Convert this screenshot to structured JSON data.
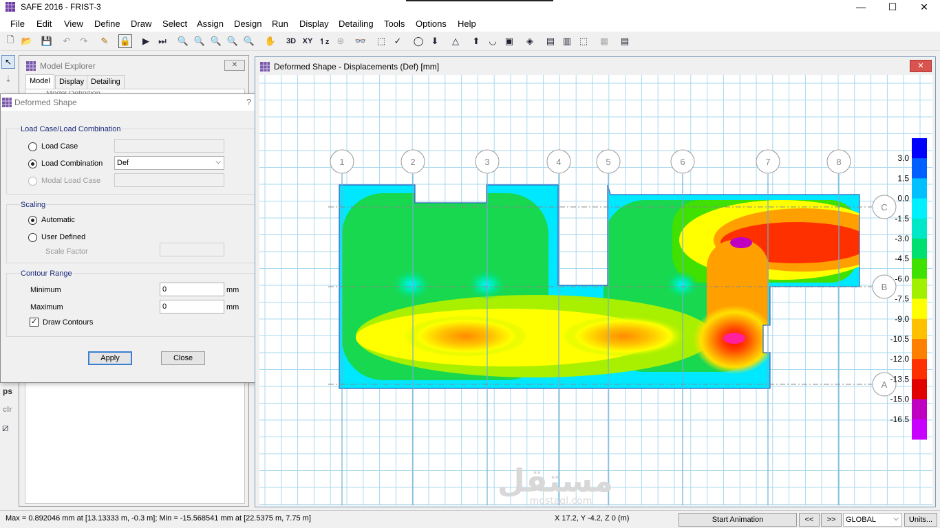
{
  "app": {
    "title": "SAFE 2016 - FRIST-3",
    "window_buttons": [
      "—",
      "☐",
      "✕"
    ]
  },
  "menu": [
    "File",
    "Edit",
    "View",
    "Define",
    "Draw",
    "Select",
    "Assign",
    "Design",
    "Run",
    "Display",
    "Detailing",
    "Tools",
    "Options",
    "Help"
  ],
  "toolbar_icons": [
    "new-file-icon",
    "open-folder-icon",
    "save-icon",
    "undo-icon",
    "redo-icon",
    "pencil-icon",
    "lock-icon",
    "run-icon",
    "run-all-icon",
    "zoom-window-icon",
    "zoom-restore-icon",
    "zoom-in-icon",
    "zoom-out-icon",
    "zoom-fit-icon",
    "pan-icon",
    "view-3d",
    "view-xy",
    "view-rz",
    "rotate-icon",
    "glasses-icon",
    "select-icon",
    "check-icon",
    "circle-icon",
    "load-icon",
    "frame-icon",
    "arrow-up-icon",
    "shape-icon",
    "camera-icon",
    "display-icon",
    "design-icon",
    "beam-icon",
    "slab-icon",
    "table-icon"
  ],
  "toolbar_labels": {
    "3d": "3D",
    "xy": "XY",
    "rz": "↿z"
  },
  "left_tools": {
    "ps": "ps",
    "clr": "clr"
  },
  "explorer": {
    "title": "Model Explorer",
    "tabs": [
      "Model",
      "Display",
      "Detailing"
    ],
    "peek": "Model Definition"
  },
  "dialog": {
    "title": "Deformed Shape",
    "help": "?",
    "group1_title": "Load Case/Load Combination",
    "load_case": "Load Case",
    "load_combination": "Load Combination",
    "load_combination_value": "Def",
    "modal_load_case": "Modal Load Case",
    "group2_title": "Scaling",
    "automatic": "Automatic",
    "user_defined": "User Defined",
    "scale_factor": "Scale Factor",
    "group3_title": "Contour Range",
    "minimum": "Minimum",
    "minimum_value": "0",
    "maximum": "Maximum",
    "maximum_value": "0",
    "unit": "mm",
    "draw_contours": "Draw Contours",
    "apply": "Apply",
    "close": "Close"
  },
  "view": {
    "title": "Deformed Shape - Displacements (Def)  [mm]",
    "grid_x": [
      "1",
      "2",
      "3",
      "4",
      "5",
      "6",
      "7",
      "8"
    ],
    "grid_y": [
      "C",
      "B",
      "A"
    ],
    "legend": [
      "3.0",
      "1.5",
      "0.0",
      "-1.5",
      "-3.0",
      "-4.5",
      "-6.0",
      "-7.5",
      "-9.0",
      "-10.5",
      "-12.0",
      "-13.5",
      "-15.0",
      "-16.5"
    ],
    "legend_colors": [
      "#0000ff",
      "#0060ff",
      "#00c0ff",
      "#00f0ff",
      "#00e8c8",
      "#00e070",
      "#40e000",
      "#a0f000",
      "#ffff00",
      "#ffc000",
      "#ff8000",
      "#ff3000",
      "#e00000",
      "#c000c0",
      "#c800ff"
    ],
    "watermark": "مستقل",
    "watermark_sub": "mostaql.com"
  },
  "status": {
    "minmax": "Max = 0.892046 mm at [13.13333 m, -0.3 m];  Min = -15.568541 mm at [22.5375 m, 7.75 m]",
    "coords": "X 17.2,  Y -4.2,  Z 0  (m)",
    "animation": "Start Animation",
    "prev": "<<",
    "next": ">>",
    "coord_system": "GLOBAL",
    "units": "Units..."
  }
}
